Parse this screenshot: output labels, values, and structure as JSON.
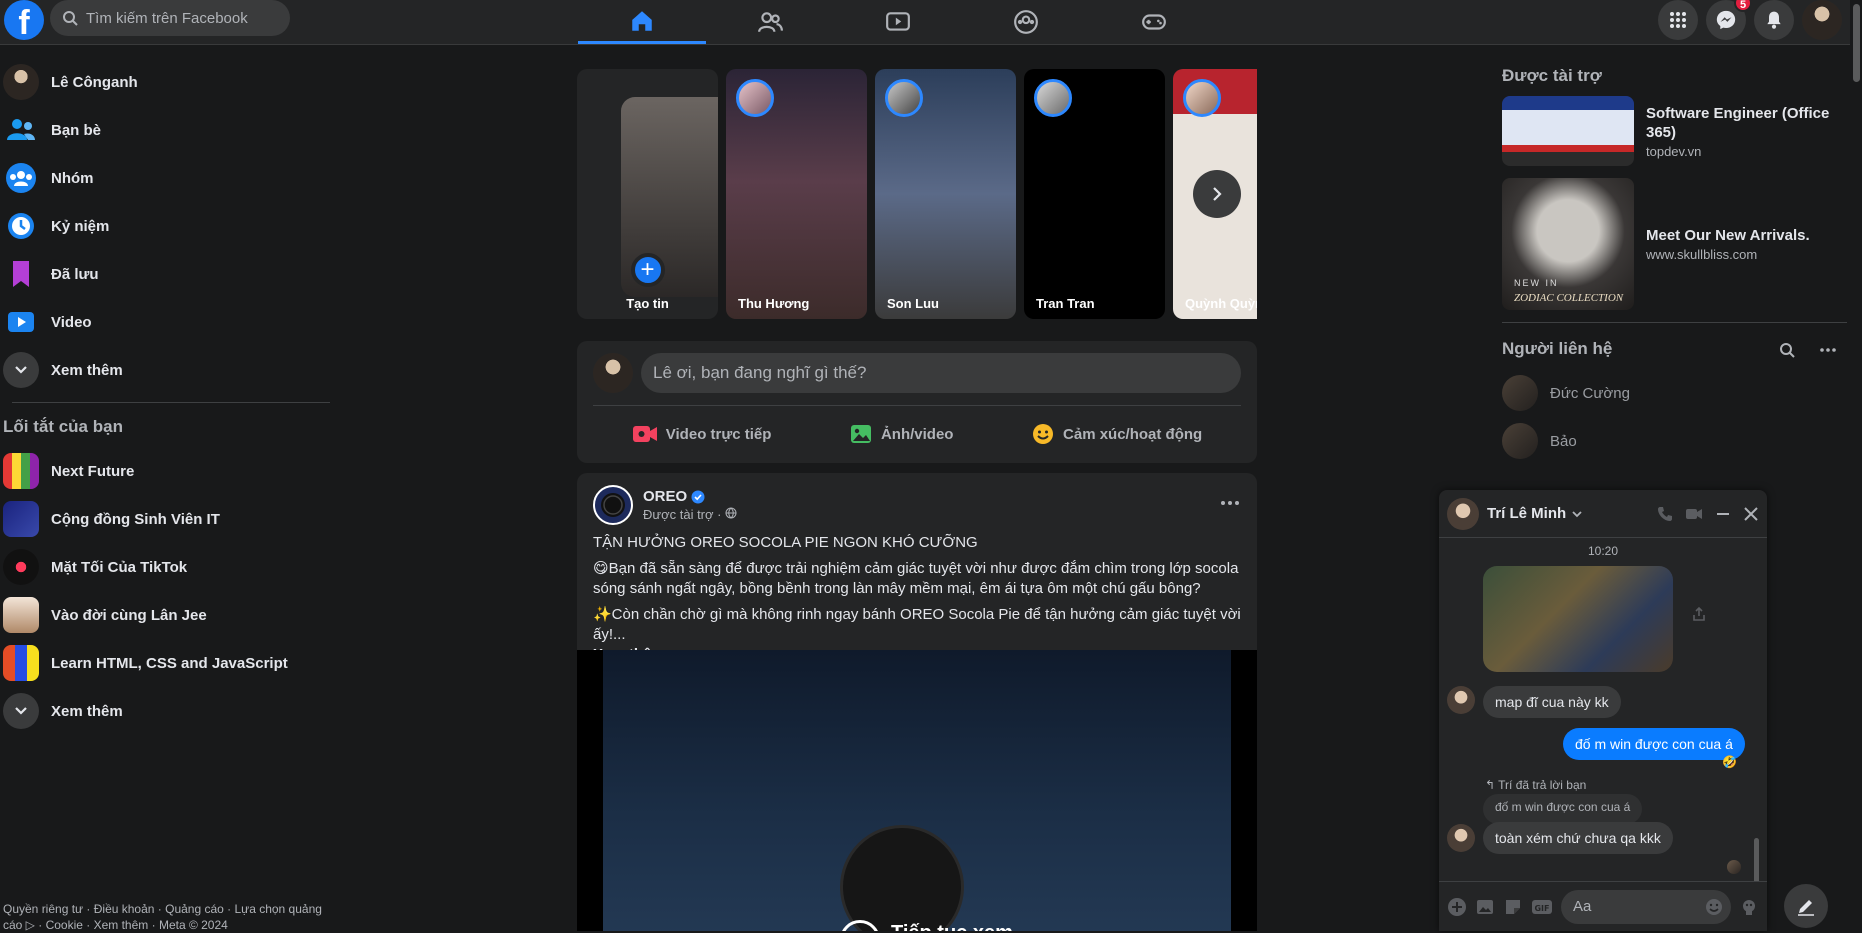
{
  "header": {
    "logo": "f",
    "search_placeholder": "Tìm kiếm trên Facebook",
    "notifications_count": "5"
  },
  "sidebar": {
    "user_name": "Lê Cônganh",
    "items": [
      {
        "label": "Bạn bè"
      },
      {
        "label": "Nhóm"
      },
      {
        "label": "Kỷ niệm"
      },
      {
        "label": "Đã lưu"
      },
      {
        "label": "Video"
      },
      {
        "label": "Xem thêm"
      }
    ],
    "shortcuts_title": "Lối tắt của bạn",
    "shortcuts": [
      {
        "label": "Next Future"
      },
      {
        "label": "Cộng đồng Sinh Viên IT"
      },
      {
        "label": "Mặt Tối Của TikTok"
      },
      {
        "label": "Vào đời cùng Lân Jee"
      },
      {
        "label": "Learn HTML, CSS and JavaScript"
      },
      {
        "label": "Xem thêm"
      }
    ],
    "footer": "Quyền riêng tư · Điều khoản · Quảng cáo · Lựa chọn quảng cáo ▷ · Cookie · Xem thêm · Meta © 2024"
  },
  "stories": {
    "create_label": "Tạo tin",
    "create_plus": "+",
    "items": [
      {
        "name": "Thu Hương"
      },
      {
        "name": "Son Luu"
      },
      {
        "name": "Tran Tran"
      },
      {
        "name": "Quỳnh Quỳnh"
      }
    ]
  },
  "composer": {
    "placeholder": "Lê ơi, bạn đang nghĩ gì thế?",
    "live_label": "Video trực tiếp",
    "photo_label": "Ảnh/video",
    "feeling_label": "Cảm xúc/hoạt động"
  },
  "post": {
    "author": "OREO",
    "subtitle": "Được tài trợ ·",
    "headline": "TẬN HƯỞNG OREO SOCOLA PIE NGON KHÓ CƯỠNG",
    "para1": "😋Bạn đã sẵn sàng để được trải nghiệm cảm giác tuyệt vời như được đắm chìm trong lớp socola sóng sánh ngất ngây, bồng bềnh trong làn mây mềm mại, êm ái tựa ôm một chú gấu bông?",
    "para2": "✨Còn chần chờ gì mà không rinh ngay bánh OREO Socola Pie để tận hưởng cảm giác tuyệt vời ấy!...",
    "see_more": "Xem thêm",
    "video_text": "Tiếp tục xem"
  },
  "right": {
    "sponsored_title": "Được tài trợ",
    "ads": [
      {
        "title": "Software Engineer (Office 365)",
        "url": "topdev.vn"
      },
      {
        "title": "Meet Our New Arrivals.",
        "url": "www.skullbliss.com"
      }
    ],
    "ad2_badge": "NEW IN",
    "ad2_caption": "ZODIAC COLLECTION",
    "contacts_title": "Người liên hệ",
    "contacts": [
      {
        "name": "Đức Cường"
      },
      {
        "name": "Bảo"
      }
    ]
  },
  "chat": {
    "name": "Trí Lê Minh",
    "time": "10:20",
    "msg1": "map đĩ cua này kk",
    "msg2": "đố m win được con cua á",
    "reply_note": "↰ Trí đã trả lời bạn",
    "quoted": "đố m win được con cua á",
    "msg3": "toàn xém chứ chưa qa kkk",
    "input_placeholder": "Aa"
  },
  "colors": {
    "bg": "#18191a",
    "surface": "#242526",
    "accent": "#2d88ff",
    "outgoing_bubble": "#0a7cff"
  }
}
